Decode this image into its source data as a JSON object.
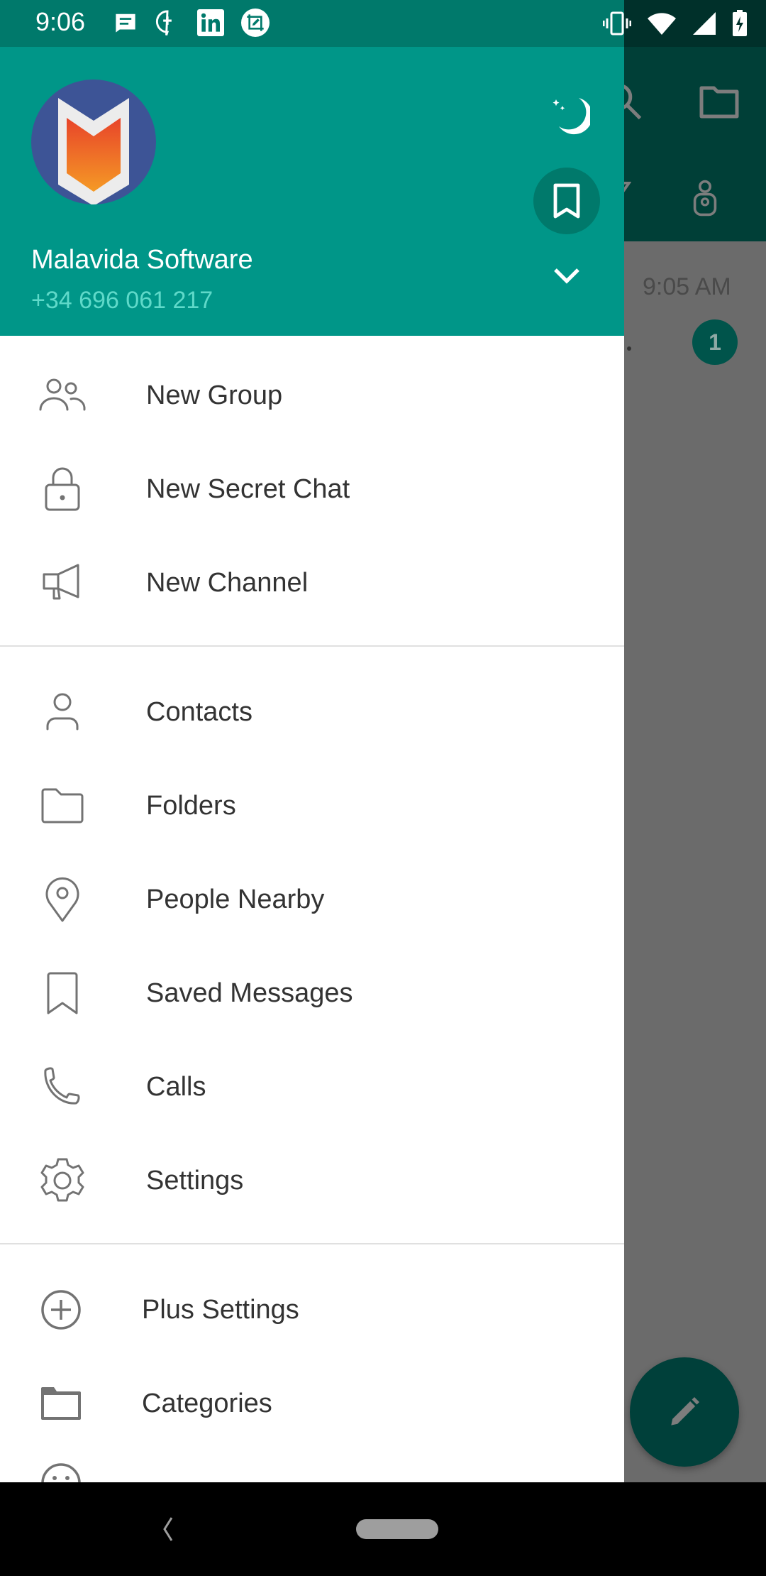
{
  "status_bar": {
    "time": "9:06",
    "notification_icons": [
      "messages-icon",
      "chat-plus-icon",
      "linkedin-icon",
      "screenshot-edit-icon"
    ],
    "system_icons": [
      "vibrate-icon",
      "wifi-icon",
      "signal-icon",
      "battery-charging-icon"
    ]
  },
  "drawer_header": {
    "account_name": "Malavida Software",
    "phone": "+34 696 061 217",
    "buttons": {
      "night_mode": "moon-icon",
      "saved": "bookmark-icon",
      "expand_accounts": "chevron-down-icon"
    }
  },
  "menu": {
    "group1": [
      {
        "label": "New Group",
        "icon": "group-icon"
      },
      {
        "label": "New Secret Chat",
        "icon": "lock-icon"
      },
      {
        "label": "New Channel",
        "icon": "megaphone-icon"
      }
    ],
    "group2": [
      {
        "label": "Contacts",
        "icon": "person-icon"
      },
      {
        "label": "Folders",
        "icon": "folder-icon"
      },
      {
        "label": "People Nearby",
        "icon": "location-pin-icon"
      },
      {
        "label": "Saved Messages",
        "icon": "bookmark-icon"
      },
      {
        "label": "Calls",
        "icon": "phone-icon"
      },
      {
        "label": "Settings",
        "icon": "gear-icon"
      }
    ],
    "group3": [
      {
        "label": "Plus Settings",
        "icon": "plus-circle-icon"
      },
      {
        "label": "Categories",
        "icon": "folder-filled-icon"
      }
    ]
  },
  "background_app": {
    "chat_time": "9:05 AM",
    "unread_count": "1"
  },
  "colors": {
    "header": "#009688",
    "status_bar": "#00796b",
    "phone_text": "#5fd9c9",
    "menu_text": "#333333",
    "menu_icon": "#737373"
  }
}
